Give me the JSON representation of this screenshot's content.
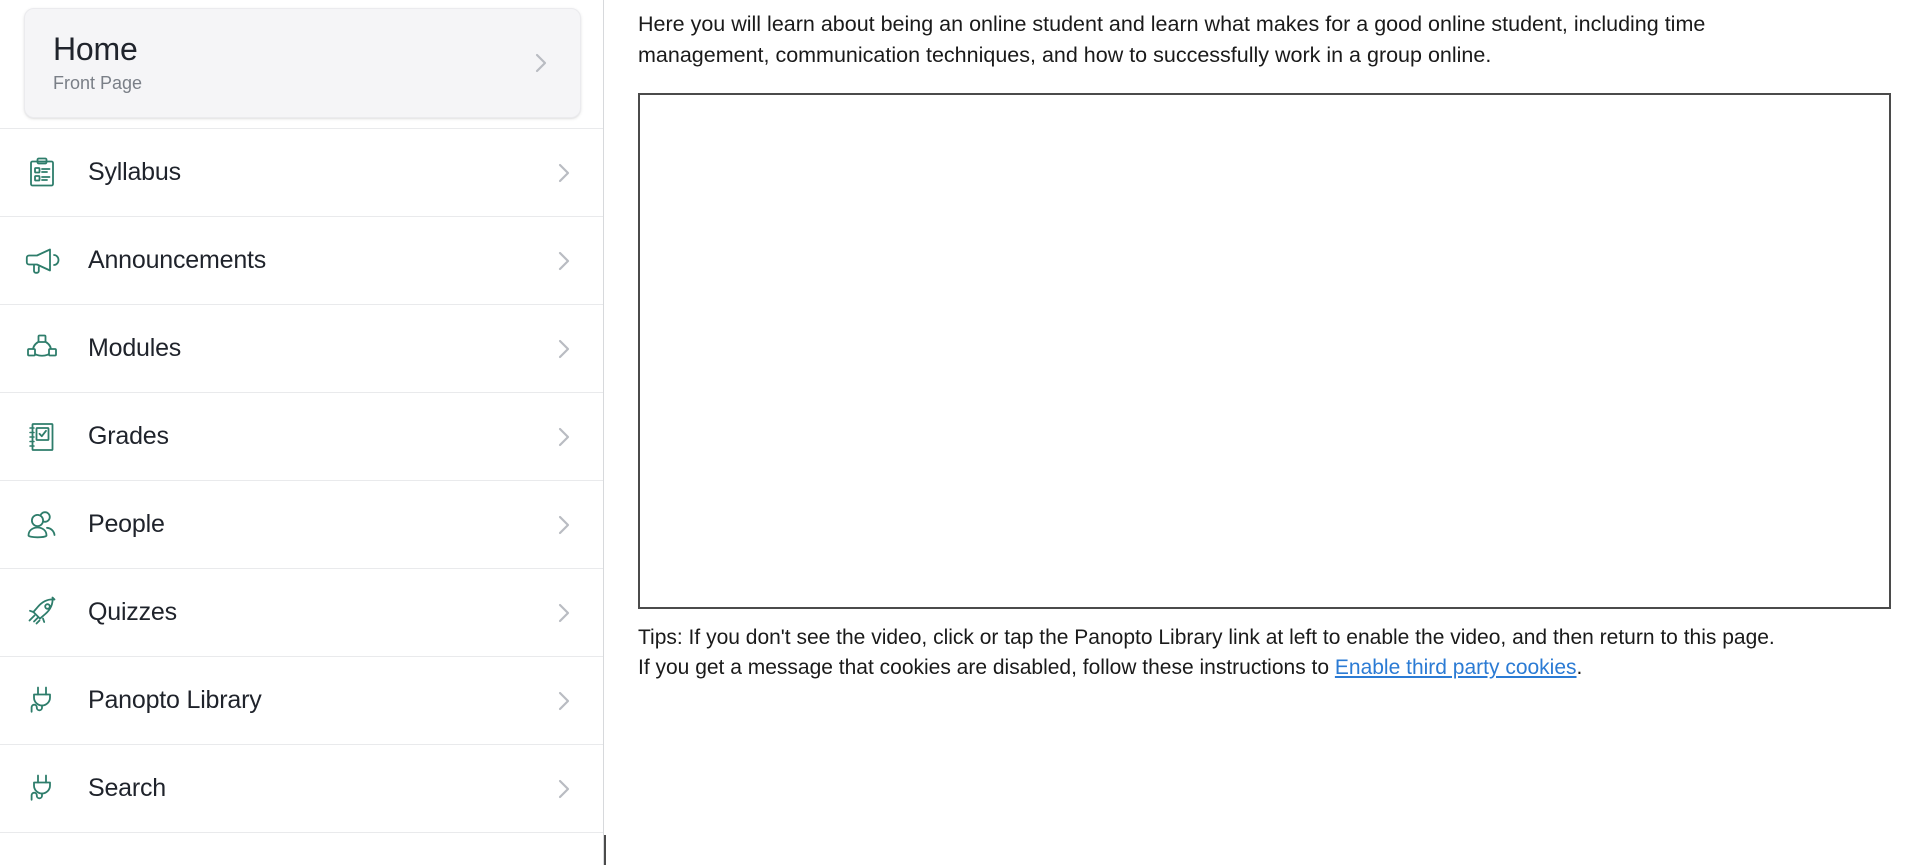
{
  "sidebar": {
    "home_card": {
      "title": "Home",
      "subtitle": "Front Page",
      "chevron_icon": "chevron-right-icon"
    },
    "items": [
      {
        "label": "Syllabus",
        "icon": "clipboard-list-icon",
        "chevron_icon": "chevron-right-icon"
      },
      {
        "label": "Announcements",
        "icon": "megaphone-icon",
        "chevron_icon": "chevron-right-icon"
      },
      {
        "label": "Modules",
        "icon": "modules-network-icon",
        "chevron_icon": "chevron-right-icon"
      },
      {
        "label": "Grades",
        "icon": "gradebook-check-icon",
        "chevron_icon": "chevron-right-icon"
      },
      {
        "label": "People",
        "icon": "people-group-icon",
        "chevron_icon": "chevron-right-icon"
      },
      {
        "label": "Quizzes",
        "icon": "rocket-icon",
        "chevron_icon": "chevron-right-icon"
      },
      {
        "label": "Panopto Library",
        "icon": "plug-icon",
        "chevron_icon": "chevron-right-icon"
      },
      {
        "label": "Search",
        "icon": "plug-icon",
        "chevron_icon": "chevron-right-icon"
      }
    ]
  },
  "main": {
    "intro_paragraph": "Here you will learn about being an online student and learn what makes for a good online student, including time management, communication techniques, and how to successfully work in a group online.",
    "video_placeholder_label": "",
    "tips_line1": "Tips: If you don't see the video, click or tap the Panopto Library link at left to enable the video, and then return to this page.",
    "tips_line2_before_link": "If you get a message that cookies are disabled, follow these instructions to ",
    "tips_link_text": "Enable third party cookies",
    "tips_line2_after_link": "."
  },
  "colors": {
    "icon_teal": "#2e7d6b",
    "link_blue": "#2b7bd4",
    "text_dark": "#1f232b",
    "muted_text": "#7a7f87",
    "divider": "#e9eaec",
    "card_bg": "#f5f5f7",
    "frame_border": "#4b4b4b"
  }
}
